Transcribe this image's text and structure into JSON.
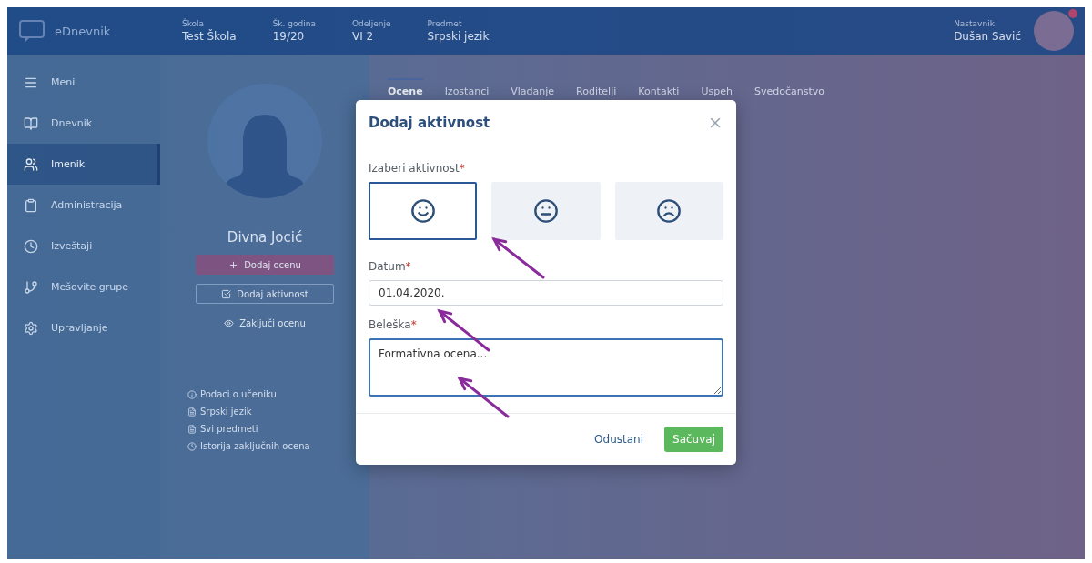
{
  "header": {
    "logo_text": "eDnevnik",
    "fields": [
      {
        "label": "Škola",
        "value": "Test Škola"
      },
      {
        "label": "Šk. godina",
        "value": "19/20"
      },
      {
        "label": "Odeljenje",
        "value": "VI 2"
      },
      {
        "label": "Predmet",
        "value": "Srpski jezik"
      }
    ],
    "user": {
      "role": "Nastavnik",
      "name": "Dušan Savić"
    }
  },
  "sidebar": {
    "items": [
      {
        "label": "Meni",
        "selected": false
      },
      {
        "label": "Dnevnik",
        "selected": false
      },
      {
        "label": "Imenik",
        "selected": true
      },
      {
        "label": "Administracija",
        "selected": false
      },
      {
        "label": "Izveštaji",
        "selected": false
      },
      {
        "label": "Mešovite grupe",
        "selected": false
      },
      {
        "label": "Upravljanje",
        "selected": false
      }
    ]
  },
  "student": {
    "name": "Divna Jocić",
    "actions": [
      {
        "kind": "primary",
        "label": "Dodaj ocenu"
      },
      {
        "kind": "outline",
        "label": "Dodaj aktivnost"
      },
      {
        "kind": "plain",
        "label": "Zaključi ocenu"
      }
    ],
    "links": [
      "Podaci o učeniku",
      "Srpski jezik",
      "Svi predmeti",
      "Istorija zaključnih ocena"
    ]
  },
  "tabs": [
    {
      "label": "Ocene",
      "selected": true
    },
    {
      "label": "Izostanci",
      "selected": false
    },
    {
      "label": "Vladanje",
      "selected": false
    },
    {
      "label": "Roditelji",
      "selected": false
    },
    {
      "label": "Kontakti",
      "selected": false
    },
    {
      "label": "Uspeh",
      "selected": false
    },
    {
      "label": "Svedočanstvo",
      "selected": false
    }
  ],
  "modal": {
    "title": "Dodaj aktivnost",
    "activity": {
      "label": "Izaberi aktivnost",
      "required_mark": "*",
      "options": [
        {
          "kind": "happy",
          "selected": true
        },
        {
          "kind": "neutral",
          "selected": false
        },
        {
          "kind": "sad",
          "selected": false
        }
      ]
    },
    "date": {
      "label": "Datum",
      "required_mark": "*",
      "value": "01.04.2020."
    },
    "note": {
      "label": "Beleška",
      "required_mark": "*",
      "value": "Formativna ocena..."
    },
    "buttons": [
      {
        "kind": "cancel",
        "label": "Odustani"
      },
      {
        "kind": "save",
        "label": "Sačuvaj"
      }
    ]
  }
}
